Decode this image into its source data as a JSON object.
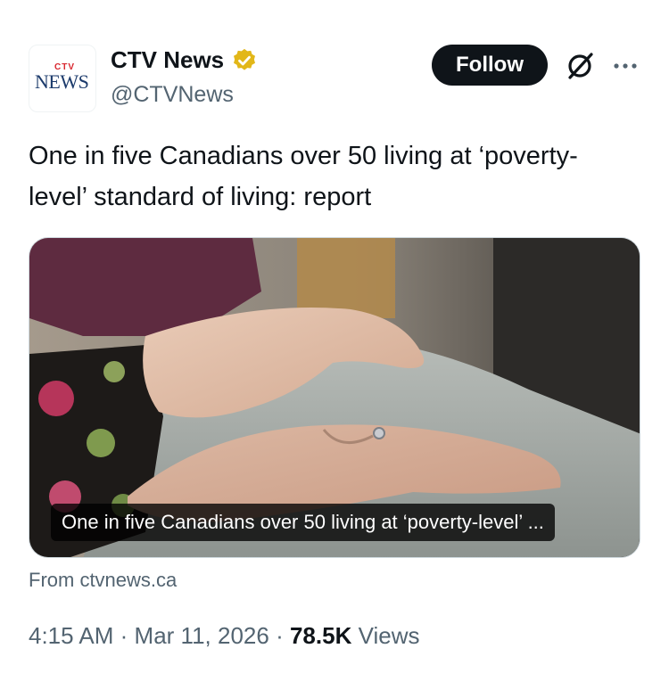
{
  "author": {
    "logo_top": "CTV",
    "logo_bottom": "NEWS",
    "display_name": "CTV News",
    "handle": "@CTVNews"
  },
  "actions": {
    "follow_label": "Follow",
    "grok_icon": "grok-icon",
    "more_icon": "more-icon"
  },
  "tweet": {
    "text": "One in five Canadians over 50 living at ‘poverty-level’ standard of living: report"
  },
  "card": {
    "caption": "One in five Canadians over 50 living at ‘poverty-level’ ...",
    "source": "From ctvnews.ca",
    "image_description": "hands-photo"
  },
  "meta": {
    "time": "4:15 AM",
    "separator": "·",
    "date": "Mar 11, 2026",
    "views_count": "78.5K",
    "views_label": "Views"
  },
  "colors": {
    "text": "#0f1419",
    "secondary": "#536471",
    "verified_gold": "#e2b719",
    "follow_bg": "#0f1419"
  }
}
